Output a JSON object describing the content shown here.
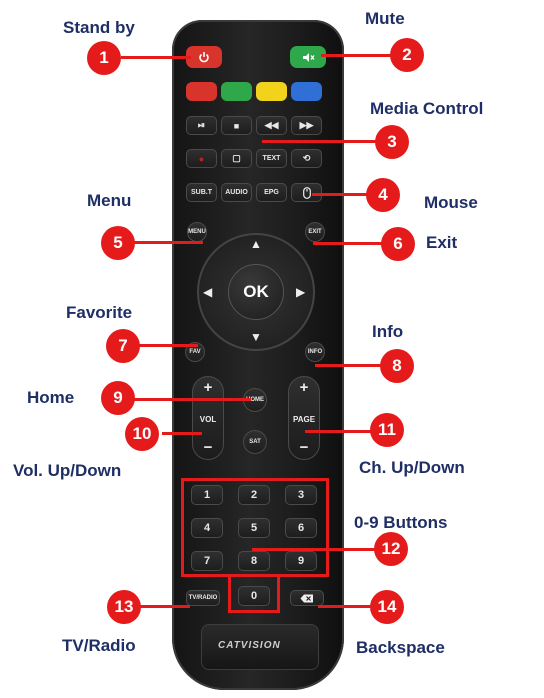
{
  "brand": {
    "logo_text": "CATVISION"
  },
  "callouts": [
    {
      "number": "1",
      "label": "Stand by"
    },
    {
      "number": "2",
      "label": "Mute"
    },
    {
      "number": "3",
      "label": "Media Control"
    },
    {
      "number": "4",
      "label": "Mouse"
    },
    {
      "number": "5",
      "label": "Menu"
    },
    {
      "number": "6",
      "label": "Exit"
    },
    {
      "number": "7",
      "label": "Favorite"
    },
    {
      "number": "8",
      "label": "Info"
    },
    {
      "number": "9",
      "label": "Home"
    },
    {
      "number": "10",
      "label": "Vol. Up/Down"
    },
    {
      "number": "11",
      "label": "Ch. Up/Down"
    },
    {
      "number": "12",
      "label": "0-9 Buttons"
    },
    {
      "number": "13",
      "label": "TV/Radio"
    },
    {
      "number": "14",
      "label": "Backspace"
    }
  ],
  "remote": {
    "power_icon": "power-icon",
    "mute_icon": "speaker-mute-icon",
    "color_keys": [
      "#d9342b",
      "#2ea84a",
      "#f2d21b",
      "#2f6fd6"
    ],
    "media_row": [
      "⏯",
      "■",
      "◀◀",
      "▶▶"
    ],
    "row2": [
      "●",
      "▢",
      "TEXT",
      "⟲"
    ],
    "row3": [
      "SUB.T",
      "AUDIO",
      "EPG"
    ],
    "mouse_icon": "mouse-icon",
    "menu": "MENU",
    "exit": "EXIT",
    "ok": "OK",
    "fav": "FAV",
    "info": "INFO",
    "home": "HOME",
    "sat": "SAT",
    "vol": "VOL",
    "page": "PAGE",
    "plus": "+",
    "minus": "−",
    "digits": [
      "1",
      "2",
      "3",
      "4",
      "5",
      "6",
      "7",
      "8",
      "9",
      "0"
    ],
    "tvradio": "TV/RADIO",
    "backspace_icon": "backspace-icon"
  },
  "colors": {
    "callout": "#e51b1b",
    "label": "#1f2f66"
  }
}
